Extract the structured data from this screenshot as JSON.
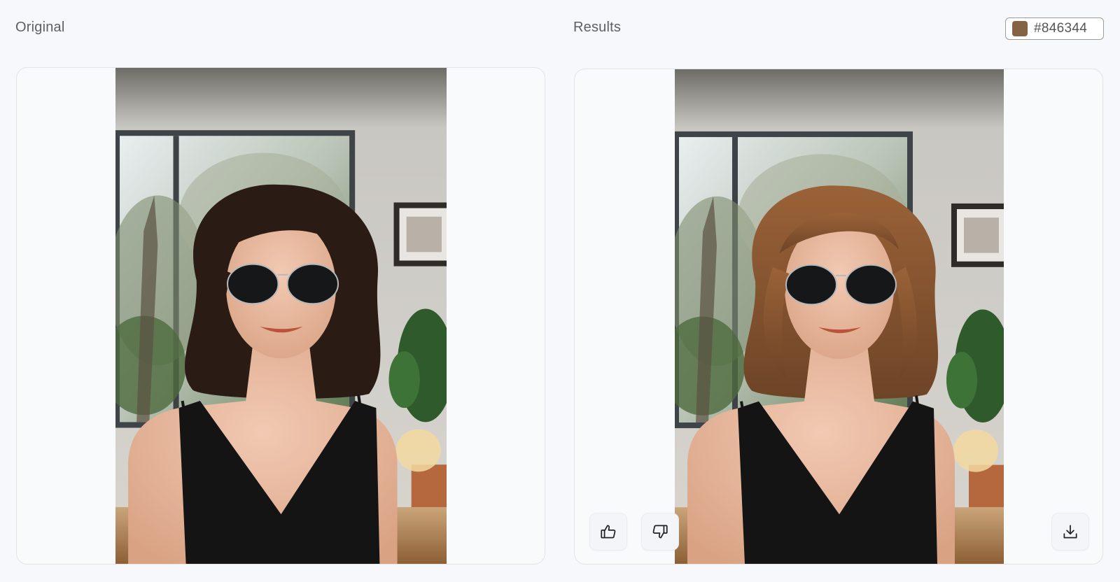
{
  "headings": {
    "original": "Original",
    "results": "Results"
  },
  "color_chip": {
    "hex_label": "#846344",
    "swatch_color": "#846344"
  },
  "images": {
    "original": {
      "hair_color": "#2a1c15"
    },
    "result": {
      "hair_color": "#8a5a33"
    }
  },
  "actions": {
    "like_icon": "thumbs-up-icon",
    "dislike_icon": "thumbs-down-icon",
    "download_icon": "download-icon"
  }
}
